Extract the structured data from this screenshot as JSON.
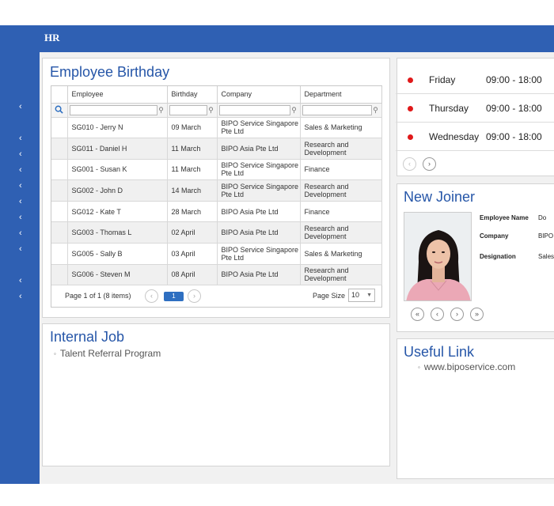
{
  "app": {
    "title": "HR"
  },
  "birthday": {
    "title": "Employee Birthday",
    "columns": [
      "Employee",
      "Birthday",
      "Company",
      "Department"
    ],
    "rows": [
      {
        "employee": "SG010 - Jerry N",
        "birthday": "09 March",
        "company": "BIPO Service Singapore Pte Ltd",
        "department": "Sales & Marketing"
      },
      {
        "employee": "SG011 - Daniel H",
        "birthday": "11 March",
        "company": "BIPO Asia Pte Ltd",
        "department": "Research and Development"
      },
      {
        "employee": "SG001 - Susan K",
        "birthday": "11 March",
        "company": "BIPO Service Singapore Pte Ltd",
        "department": "Finance"
      },
      {
        "employee": "SG002 - John D",
        "birthday": "14 March",
        "company": "BIPO Service Singapore Pte Ltd",
        "department": "Research and Development"
      },
      {
        "employee": "SG012 - Kate T",
        "birthday": "28 March",
        "company": "BIPO Asia Pte Ltd",
        "department": "Finance"
      },
      {
        "employee": "SG003 - Thomas L",
        "birthday": "02 April",
        "company": "BIPO Asia Pte Ltd",
        "department": "Research and Development"
      },
      {
        "employee": "SG005 - Sally B",
        "birthday": "03 April",
        "company": "BIPO Service Singapore Pte Ltd",
        "department": "Sales & Marketing"
      },
      {
        "employee": "SG006 - Steven M",
        "birthday": "08 April",
        "company": "BIPO Asia Pte Ltd",
        "department": "Research and Development"
      }
    ],
    "pager": {
      "summary": "Page 1 of 1 (8 items)",
      "current_page": "1",
      "page_size_label": "Page Size",
      "page_size": "10"
    }
  },
  "schedule": {
    "rows": [
      {
        "day": "Friday",
        "time": "09:00 - 18:00"
      },
      {
        "day": "Thursday",
        "time": "09:00 - 18:00"
      },
      {
        "day": "Wednesday",
        "time": "09:00 - 18:00"
      }
    ]
  },
  "new_joiner": {
    "title": "New Joiner",
    "fields": [
      {
        "label": "Employee Name",
        "value": "Do"
      },
      {
        "label": "Company",
        "value": "BIPO"
      },
      {
        "label": "Designation",
        "value": "Sales"
      }
    ]
  },
  "internal_job": {
    "title": "Internal Job",
    "items": [
      "Talent Referral Program"
    ]
  },
  "useful_link": {
    "title": "Useful Link",
    "items": [
      "www.biposervice.com"
    ]
  },
  "icons": {
    "sidebar": "chevron-left-icon",
    "search": "search-icon",
    "filter": "filter-pin-icon",
    "status_dot": "red-dot-icon",
    "prev": "chevron-left-circle-icon",
    "next": "chevron-right-circle-icon",
    "first": "double-chevron-left-circle-icon",
    "last": "double-chevron-right-circle-icon"
  },
  "colors": {
    "brand": "#2f60b3",
    "title": "#2656a8",
    "status_dot": "#e0191a",
    "pager_active": "#2e6fc1"
  }
}
